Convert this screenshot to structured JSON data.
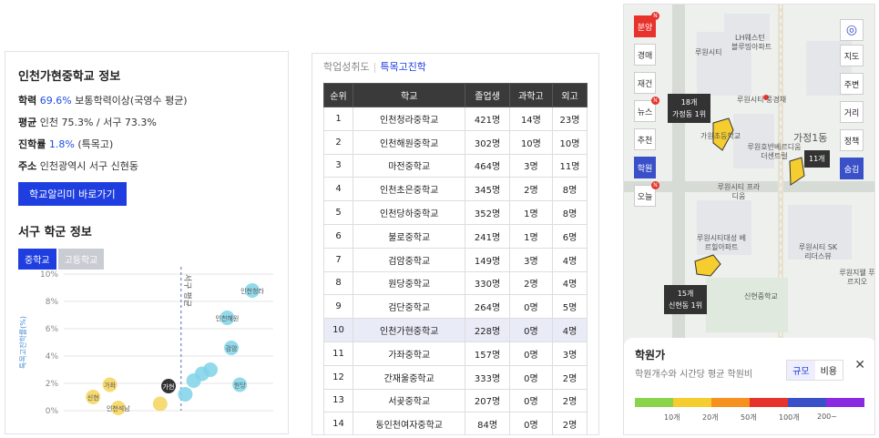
{
  "left": {
    "title": "인천가현중학교 정보",
    "achievement_label": "학력",
    "achievement_value": "69.6%",
    "achievement_desc": "보통학력이상(국영수 평균)",
    "average_label": "평균",
    "average_text": "인천 75.3% / 서구 73.3%",
    "entrance_label": "진학률",
    "entrance_value": "1.8%",
    "entrance_desc": "(특목고)",
    "address_label": "주소",
    "address_text": "인천광역시 서구 신현동",
    "link_button": "학교알리미 바로가기",
    "district_title": "서구 학군 정보",
    "seg_middle": "중학교",
    "seg_high": "고등학교"
  },
  "chart_data": {
    "type": "scatter",
    "ylabel": "특목고진학률(%)",
    "yticks": [
      "10%",
      "8%",
      "6%",
      "4%",
      "2%",
      "0%"
    ],
    "ylim": [
      0,
      10
    ],
    "ref_line_label": "서구 평균",
    "points": [
      {
        "label": "인천청라",
        "x": 90,
        "y": 8.8,
        "color": "#7fd3e8"
      },
      {
        "label": "인천해원",
        "x": 84,
        "y": 6.8,
        "color": "#7fd3e8"
      },
      {
        "label": "검암",
        "x": 85,
        "y": 4.6,
        "color": "#7fd3e8"
      },
      {
        "label": "원당",
        "x": 87,
        "y": 1.9,
        "color": "#7fd3e8"
      },
      {
        "label": "",
        "x": 80,
        "y": 3.0,
        "color": "#7fd3e8"
      },
      {
        "label": "",
        "x": 78,
        "y": 2.7,
        "color": "#7fd3e8"
      },
      {
        "label": "",
        "x": 76,
        "y": 2.2,
        "color": "#7fd3e8"
      },
      {
        "label": "",
        "x": 74,
        "y": 1.2,
        "color": "#7fd3e8"
      },
      {
        "label": "가좌",
        "x": 56,
        "y": 1.9,
        "color": "#f5d35a"
      },
      {
        "label": "신현",
        "x": 52,
        "y": 1.0,
        "color": "#f5d35a"
      },
      {
        "label": "인천석남",
        "x": 58,
        "y": 0.2,
        "color": "#f5d35a"
      },
      {
        "label": "",
        "x": 68,
        "y": 0.5,
        "color": "#f5d35a"
      },
      {
        "label": "가현",
        "x": 70,
        "y": 1.8,
        "color": "#111111"
      }
    ]
  },
  "mid": {
    "tab1": "학업성취도",
    "tab2": "특목고진학",
    "headers": [
      "순위",
      "학교",
      "졸업생",
      "과학고",
      "외고"
    ],
    "rows": [
      [
        "1",
        "인천청라중학교",
        "421명",
        "14명",
        "23명"
      ],
      [
        "2",
        "인천해원중학교",
        "302명",
        "10명",
        "10명"
      ],
      [
        "3",
        "마전중학교",
        "464명",
        "3명",
        "11명"
      ],
      [
        "4",
        "인천초은중학교",
        "345명",
        "2명",
        "8명"
      ],
      [
        "5",
        "인천당하중학교",
        "352명",
        "1명",
        "8명"
      ],
      [
        "6",
        "불로중학교",
        "241명",
        "1명",
        "6명"
      ],
      [
        "7",
        "검암중학교",
        "149명",
        "3명",
        "4명"
      ],
      [
        "8",
        "원당중학교",
        "330명",
        "2명",
        "4명"
      ],
      [
        "9",
        "검단중학교",
        "264명",
        "0명",
        "5명"
      ],
      [
        "10",
        "인천가현중학교",
        "228명",
        "0명",
        "4명"
      ],
      [
        "11",
        "가좌중학교",
        "157명",
        "0명",
        "3명"
      ],
      [
        "12",
        "간재울중학교",
        "333명",
        "0명",
        "2명"
      ],
      [
        "13",
        "서곶중학교",
        "207명",
        "0명",
        "2명"
      ],
      [
        "14",
        "동인천여자중학교",
        "84명",
        "0명",
        "2명"
      ]
    ]
  },
  "map": {
    "left_buttons": [
      "분양",
      "경매",
      "재건",
      "뉴스",
      "추천",
      "학원",
      "오늘"
    ],
    "badge_n": "N",
    "right_buttons": [
      "지도",
      "주변",
      "거리",
      "정책",
      "숨김"
    ],
    "callouts": [
      {
        "count": "18개",
        "area": "가정동 1위"
      },
      {
        "count": "11개",
        "area": ""
      },
      {
        "count": "15개",
        "area": "신현동 1위"
      }
    ],
    "labels": [
      "LH웨스턴",
      "블루밍아파트",
      "루원시티",
      "루원시티 풍경채",
      "가원초등학교",
      "루원호반베르디움 더센트럴",
      "가정1동",
      "루원시티 프라디움",
      "루원시티대성 베르힐아파트",
      "루원시티 SK리더스뷰",
      "신현중학교",
      "루원지웰 푸르지오"
    ],
    "sheet_title": "학원가",
    "sheet_desc": "학원개수와 시간당 평균 학원비",
    "toggle_on": "규모",
    "toggle_off": "비용",
    "legend_colors": [
      "#8bd34a",
      "#f5cd2f",
      "#f6901e",
      "#e8322c",
      "#3a50c8",
      "#8a2be2"
    ],
    "legend_ticks": [
      "10개",
      "20개",
      "50개",
      "100개",
      "200~"
    ]
  }
}
